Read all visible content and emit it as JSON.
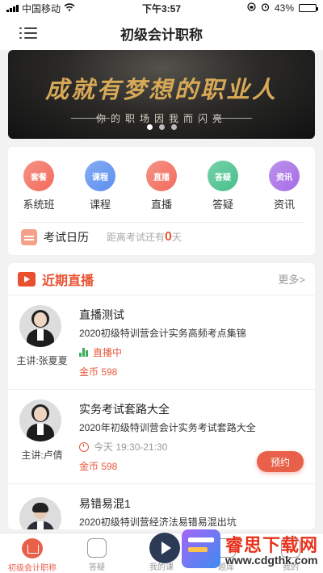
{
  "status_bar": {
    "carrier": "中国移动",
    "time": "下午3:57",
    "battery": "43%",
    "battery_level": 0.43
  },
  "nav": {
    "title": "初级会计职称",
    "menu_icon": "list-icon"
  },
  "banner": {
    "title": "成就有梦想的职业人",
    "subtitle": "你的职场因我而闪亮",
    "slide_count": 3,
    "active_slide": 1
  },
  "categories": [
    {
      "badge": "套餐",
      "label": "系统班",
      "color": "#f26b5b"
    },
    {
      "badge": "课程",
      "label": "课程",
      "color": "#5b8ff0"
    },
    {
      "badge": "直播",
      "label": "直播",
      "color": "#f26b5b"
    },
    {
      "badge": "答疑",
      "label": "答疑",
      "color": "#46c08b"
    },
    {
      "badge": "资讯",
      "label": "资讯",
      "color": "#a56be6"
    }
  ],
  "calendar": {
    "title": "考试日历",
    "countdown_prefix": "距离考试还有",
    "days": "0",
    "countdown_suffix": "天"
  },
  "live": {
    "title": "近期直播",
    "more": "更多>",
    "courses": [
      {
        "title": "直播测试",
        "description": "2020初级特训营会计实务高频考点集锦",
        "teacher": "主讲:张夏夏",
        "status": "直播中",
        "status_color": "#e55a3c",
        "price": "金币 598"
      },
      {
        "title": "实务考试套路大全",
        "description": "2020年初级特训营会计实务考试套路大全",
        "teacher": "主讲:卢倩",
        "time": "今天 19:30-21:30",
        "price": "金币 598",
        "action": "预约"
      },
      {
        "title": "易错易混1",
        "description": "2020初级特训营经济法易错易混出坑"
      }
    ]
  },
  "tabbar": [
    {
      "label": "初级会计职称",
      "active": true
    },
    {
      "label": "答疑",
      "active": false
    },
    {
      "label": "我的课",
      "active": false
    },
    {
      "label": "题库",
      "active": false
    },
    {
      "label": "我的",
      "active": false
    }
  ],
  "watermark": {
    "title": "睿思下载网",
    "url": "www.cdgthk.com"
  }
}
